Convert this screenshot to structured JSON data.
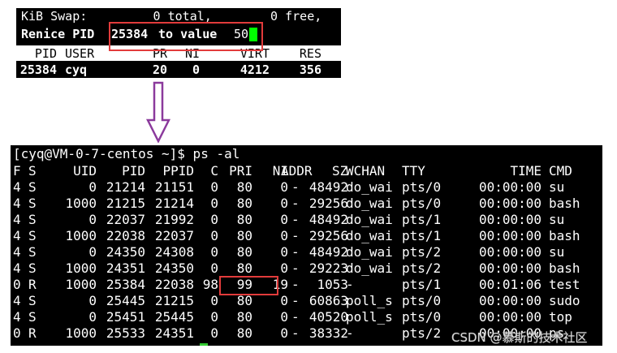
{
  "top_screen": {
    "swap_line": "KiB Swap:         0 total,        0 free,",
    "renice_prompt_prefix": "Renice PID ",
    "renice_pid": "25384",
    "renice_mid": " to value ",
    "renice_value": "50",
    "headers": [
      "PID",
      "USER",
      "PR",
      "NI",
      "VIRT",
      "RES"
    ],
    "row": {
      "pid": "25384",
      "user": "cyq",
      "pr": "20",
      "ni": "0",
      "virt": "4212",
      "res": "356"
    }
  },
  "ps_screen": {
    "prompt": "[cyq@VM-0-7-centos ~]$ ps -al",
    "headers": [
      "F",
      "S",
      "UID",
      "PID",
      "PPID",
      "C",
      "PRI",
      "NI",
      "ADDR",
      "SZ",
      "WCHAN",
      "TTY",
      "TIME",
      "CMD"
    ],
    "rows": [
      [
        "4",
        "S",
        "0",
        "21214",
        "21151",
        "0",
        "80",
        "0",
        "-",
        "48492",
        "do_wai",
        "pts/0",
        "00:00:00",
        "su"
      ],
      [
        "4",
        "S",
        "1000",
        "21215",
        "21214",
        "0",
        "80",
        "0",
        "-",
        "29256",
        "do_wai",
        "pts/0",
        "00:00:00",
        "bash"
      ],
      [
        "4",
        "S",
        "0",
        "22037",
        "21992",
        "0",
        "80",
        "0",
        "-",
        "48492",
        "do_wai",
        "pts/1",
        "00:00:00",
        "su"
      ],
      [
        "4",
        "S",
        "1000",
        "22038",
        "22037",
        "0",
        "80",
        "0",
        "-",
        "29256",
        "do_wai",
        "pts/1",
        "00:00:00",
        "bash"
      ],
      [
        "4",
        "S",
        "0",
        "24350",
        "24308",
        "0",
        "80",
        "0",
        "-",
        "48492",
        "do_wai",
        "pts/2",
        "00:00:00",
        "su"
      ],
      [
        "4",
        "S",
        "1000",
        "24351",
        "24350",
        "0",
        "80",
        "0",
        "-",
        "29223",
        "do_wai",
        "pts/2",
        "00:00:00",
        "bash"
      ],
      [
        "0",
        "R",
        "1000",
        "25384",
        "22038",
        "98",
        "99",
        "19",
        "-",
        "1053",
        "-",
        "pts/1",
        "00:01:06",
        "test"
      ],
      [
        "4",
        "S",
        "0",
        "25445",
        "21215",
        "0",
        "80",
        "0",
        "-",
        "60863",
        "poll_s",
        "pts/0",
        "00:00:00",
        "sudo"
      ],
      [
        "4",
        "S",
        "0",
        "25451",
        "25445",
        "0",
        "80",
        "0",
        "-",
        "40520",
        "poll_s",
        "pts/0",
        "00:00:00",
        "top"
      ],
      [
        "0",
        "R",
        "1000",
        "25533",
        "24351",
        "0",
        "80",
        "0",
        "-",
        "38332",
        "-",
        "pts/2",
        "00:00:00",
        "ps"
      ]
    ]
  },
  "watermark": "CSDN @慕斯的技术社区",
  "colors": {
    "terminal_bg": "#000000",
    "terminal_fg": "#ffffff",
    "highlight_box": "#e23b3b",
    "cursor": "#00ff00",
    "arrow": "#8b3a9c"
  }
}
